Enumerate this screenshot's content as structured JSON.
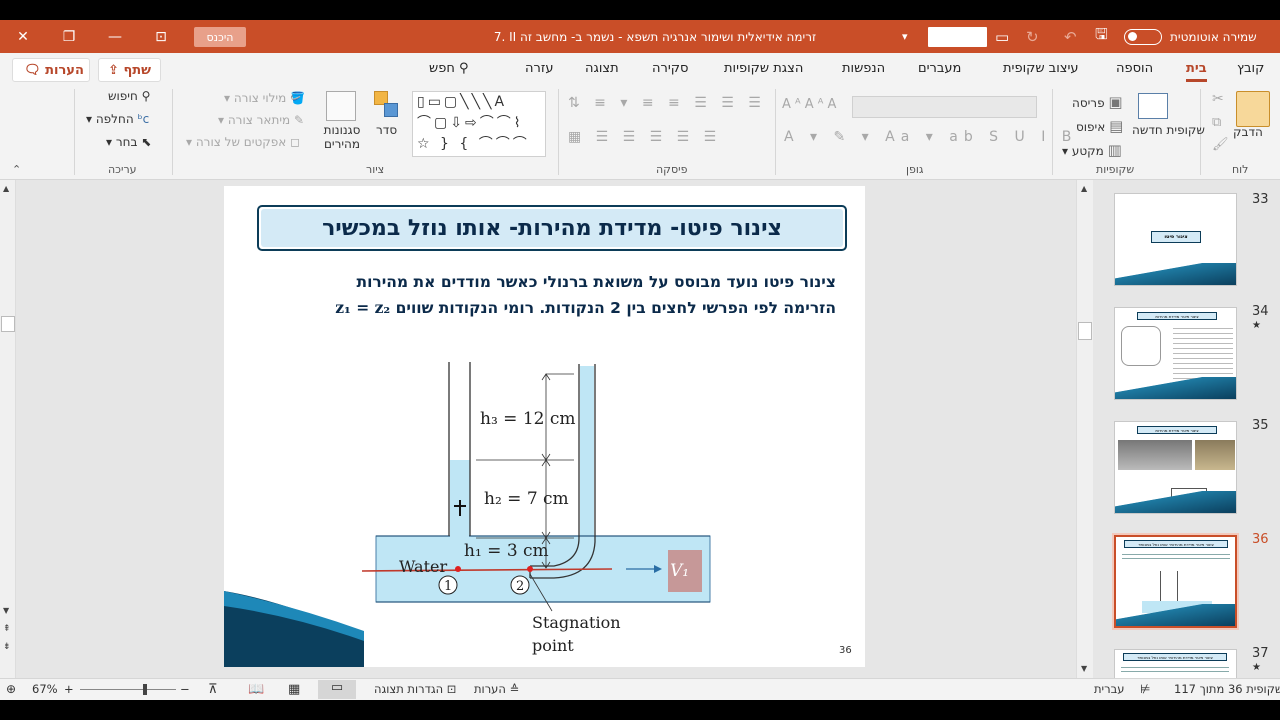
{
  "window": {
    "title": "7.  II  זרימה אידיאלית ושימור אנרגיה תשפא  -  נשמר ב- מחשב זה",
    "autosave_label": "שמירה אוטומטית",
    "signin_label": "היכנס",
    "close_glyph": "✕",
    "restore_glyph": "❐",
    "minimize_glyph": "—",
    "ribbon_display_glyph": "⊡"
  },
  "tabs": {
    "items": [
      "קובץ",
      "בית",
      "הוספה",
      "עיצוב שקופית",
      "מעברים",
      "הנפשות",
      "הצגת שקופיות",
      "סקירה",
      "תצוגה",
      "עזרה",
      "חפש"
    ],
    "active": "בית",
    "share_label": "שתף",
    "notes_label": "הערות"
  },
  "ribbon": {
    "clipboard": {
      "label": "לוח",
      "paste": "הדבק"
    },
    "slides": {
      "label": "שקופיות",
      "new_slide": "שקופית חדשה",
      "layout": "פריסה",
      "reset": "איפוס",
      "section": "מקטע"
    },
    "font": {
      "label": "גופן"
    },
    "paragraph": {
      "label": "פיסקה"
    },
    "drawing": {
      "label": "ציור",
      "arrange": "סדר",
      "quick_styles": "סגנונות מהירים",
      "fill": "מילוי צורה",
      "outline": "מיתאר צורה",
      "effects": "אפקטים של צורה"
    },
    "editing": {
      "label": "עריכה",
      "find": "חיפוש",
      "replace": "החלפה",
      "select": "בחר"
    }
  },
  "slide": {
    "title": "צינור פיטו- מדידת מהירות- אותו נוזל במכשיר",
    "body_line1": "צינור פיטו נועד מבוסס על משואת ברנולי כאשר מודדים את מהירות",
    "body_line2": "הזרימה לפי הפרשי לחצים בין 2 הנקודות. רומי הנקודות שווים",
    "formula": "z₁ = z₂",
    "number": "36",
    "diagram": {
      "h3": "h₃ = 12 cm",
      "h2": "h₂ = 7 cm",
      "h1": "h₁ = 3 cm",
      "water": "Water",
      "point1": "1",
      "point2": "2",
      "velocity": "V₁",
      "stagnation_line1": "Stagnation",
      "stagnation_line2": "point"
    }
  },
  "thumbnails": [
    {
      "number": "33",
      "star": "",
      "title": "צינור פיטו"
    },
    {
      "number": "34",
      "star": "★",
      "title": "צינור פיטו- מדידת מהירות"
    },
    {
      "number": "35",
      "star": "",
      "title": "צינור פיטו- מדידת מהירות"
    },
    {
      "number": "36",
      "star": "",
      "title": "צינור פיטו- מדידת מהירות- אותו נוזל במכשיר"
    },
    {
      "number": "37",
      "star": "★",
      "title": "צינור פיטו- מדידת מהירות- אותו נוזל במכשיר"
    }
  ],
  "selected_thumbnail": "36",
  "status": {
    "slide_count": "שקופית 36 מתוך 117",
    "language": "עברית",
    "notes": "הערות",
    "display_settings": "הגדרות תצוגה",
    "zoom": "67%"
  },
  "colors": {
    "accent": "#c94e28",
    "title_fill": "#d4eaf6",
    "title_border": "#0c3c58",
    "water": "#bfe6f5",
    "text_dark": "#0b2a4a"
  }
}
